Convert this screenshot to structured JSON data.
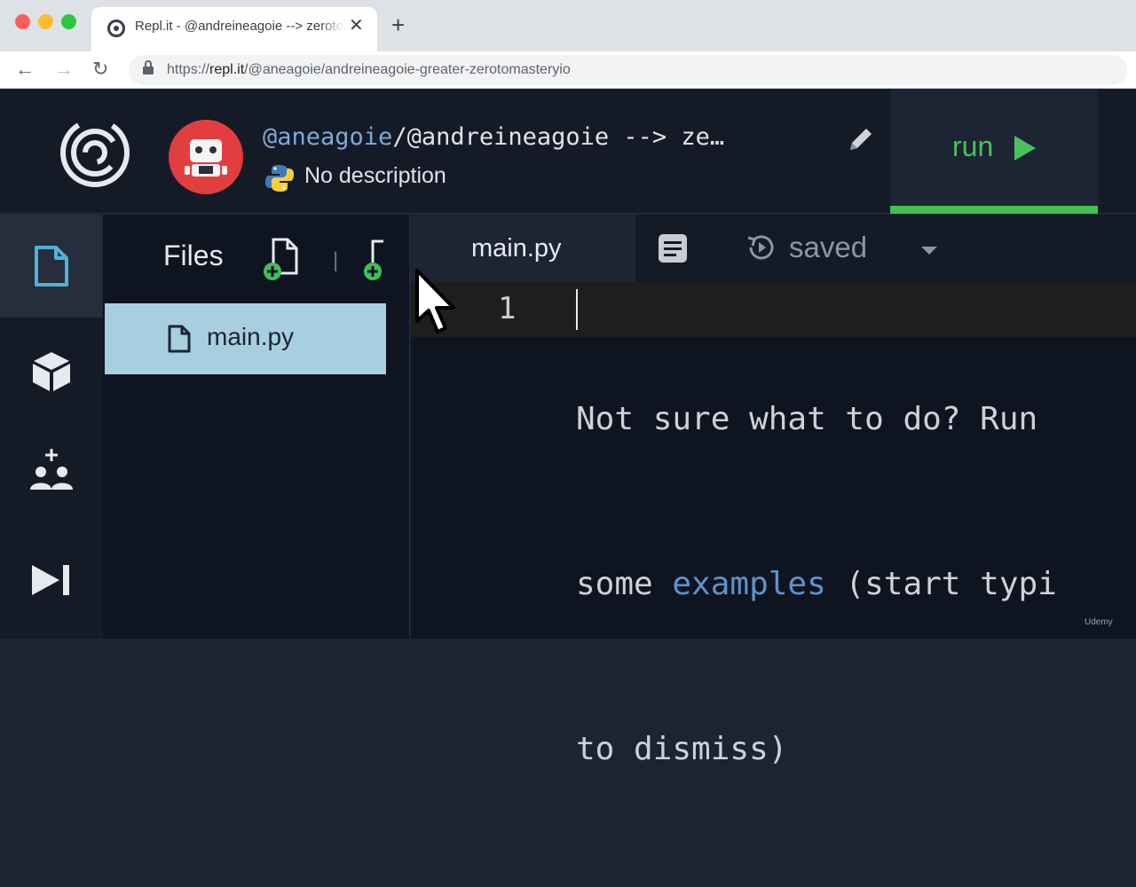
{
  "browser": {
    "tab_title": "Repl.it - @andreineagoie --> zerotomasteryio",
    "tab_close": "✕",
    "new_tab": "+",
    "url_scheme": "https://",
    "url_host": "repl.it",
    "url_path": "/@aneagoie/andreineagoie-greater-zerotomasteryio",
    "back": "←",
    "forward": "→",
    "reload": "↻"
  },
  "header": {
    "user": "@aneagoie",
    "repl_name": "/@andreineagoie --> ze…",
    "description": "No description",
    "run_label": "run",
    "accent": "#48c15b"
  },
  "files": {
    "title": "Files",
    "separator": "|",
    "items": [
      {
        "label": "main.py"
      }
    ]
  },
  "editor": {
    "tab_label": "main.py",
    "saved_label": "saved",
    "line_number": "1",
    "placeholder_lines": [
      "Not sure what to do? Run",
      "some ",
      "examples",
      " (start typi",
      "to dismiss)"
    ]
  },
  "watermark": "Udemy"
}
